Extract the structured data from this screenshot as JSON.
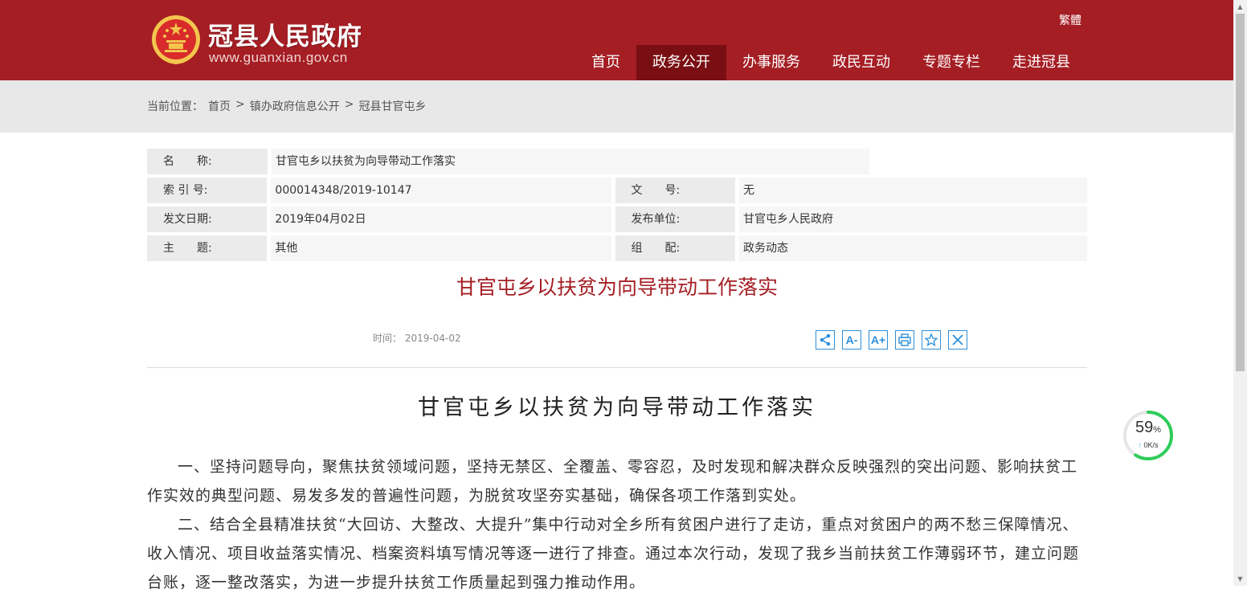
{
  "header": {
    "site_name": "冠县人民政府",
    "site_url": "www.guanxian.gov.cn",
    "lang_switch": "繁體",
    "nav": [
      {
        "label": "首页",
        "active": false
      },
      {
        "label": "政务公开",
        "active": true
      },
      {
        "label": "办事服务",
        "active": false
      },
      {
        "label": "政民互动",
        "active": false
      },
      {
        "label": "专题专栏",
        "active": false
      },
      {
        "label": "走进冠县",
        "active": false
      }
    ],
    "colors": {
      "brand": "#a41e24",
      "nav_active": "#7a0f13"
    }
  },
  "breadcrumb": {
    "prefix": "当前位置：",
    "items": [
      "首页",
      "镇办政府信息公开",
      "冠县甘官屯乡"
    ],
    "separator": ">"
  },
  "meta": {
    "name_label": "名　　称:",
    "name_value": "甘官屯乡以扶贫为向导带动工作落实",
    "index_label": "索 引 号:",
    "index_value": "000014348/2019-10147",
    "doc_no_label": "文　　号:",
    "doc_no_value": "无",
    "date_label": "发文日期:",
    "date_value": "2019年04月02日",
    "publisher_label": "发布单位:",
    "publisher_value": "甘官屯乡人民政府",
    "topic_label": "主　　题:",
    "topic_value": "其他",
    "category_label": "组　　配:",
    "category_value": "政务动态"
  },
  "article": {
    "red_title": "甘官屯乡以扶贫为向导带动工作落实",
    "time_label": "时间：",
    "time_value": "2019-04-02",
    "tools": [
      {
        "name": "share-icon",
        "text": ""
      },
      {
        "name": "font-decrease-icon",
        "text": "A-"
      },
      {
        "name": "font-increase-icon",
        "text": "A+"
      },
      {
        "name": "print-icon",
        "text": ""
      },
      {
        "name": "favorite-icon",
        "text": ""
      },
      {
        "name": "close-icon",
        "text": ""
      }
    ],
    "title": "甘官屯乡以扶贫为向导带动工作落实",
    "paragraphs": [
      "一、坚持问题导向，聚焦扶贫领域问题，坚持无禁区、全覆盖、零容忍，及时发现和解决群众反映强烈的突出问题、影响扶贫工作实效的典型问题、易发多发的普遍性问题，为脱贫攻坚夯实基础，确保各项工作落到实处。",
      "二、结合全县精准扶贫“大回访、大整改、大提升”集中行动对全乡所有贫困户进行了走访，重点对贫困户的两不愁三保障情况、收入情况、项目收益落实情况、档案资料填写情况等逐一进行了排查。通过本次行动，发现了我乡当前扶贫工作薄弱环节，建立问题台账，逐一整改落实，为进一步提升扶贫工作质量起到强力推动作用。"
    ]
  },
  "speed_widget": {
    "percent": "59",
    "percent_unit": "%",
    "percent_value": 59,
    "rate_arrow": "↑",
    "rate": "0K/s",
    "ring_color": "#2ecc5a"
  }
}
